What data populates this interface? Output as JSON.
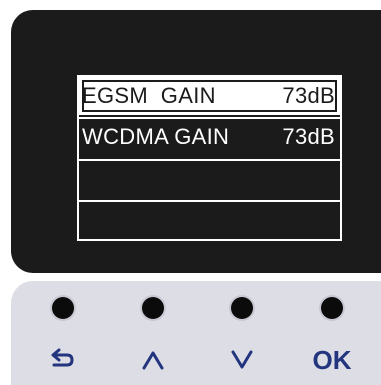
{
  "display": {
    "rows": [
      {
        "name": "EGSM  GAIN",
        "value": "73dB",
        "selected": true
      },
      {
        "name": "WCDMA GAIN",
        "value": "73dB",
        "selected": false
      },
      {
        "name": "",
        "value": "",
        "selected": false
      },
      {
        "name": "",
        "value": "",
        "selected": false
      }
    ]
  },
  "keypad": {
    "buttons": [
      {
        "icon": "back-arrow-icon",
        "label": ""
      },
      {
        "icon": "up-chevron-icon",
        "label": ""
      },
      {
        "icon": "down-chevron-icon",
        "label": ""
      },
      {
        "icon": "",
        "label": "OK"
      }
    ]
  },
  "colors": {
    "screen_bg": "#1b1b1b",
    "screen_fg": "#ffffff",
    "keypad_bg": "#dcdde5",
    "key_dot": "#0b0b0b",
    "key_label": "#23357e"
  }
}
